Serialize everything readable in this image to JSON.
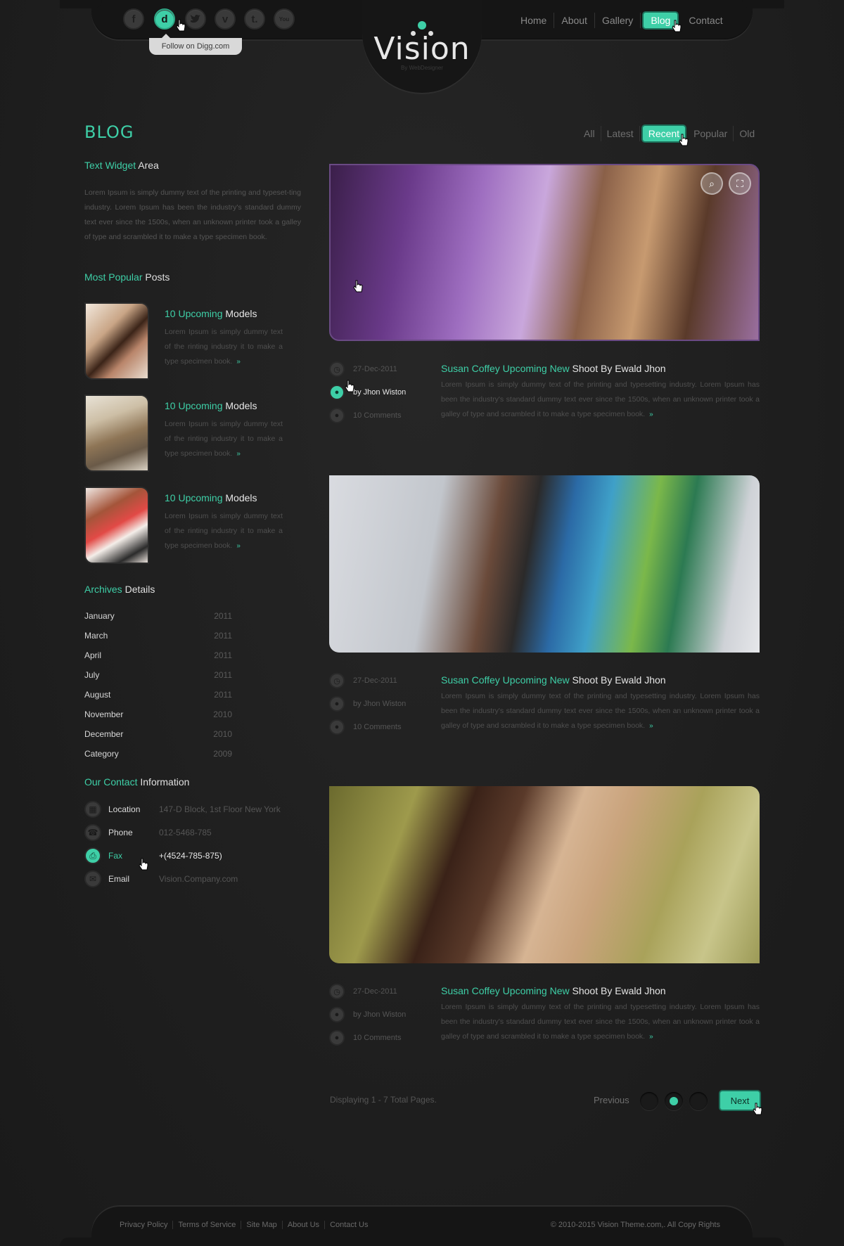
{
  "header": {
    "social": [
      {
        "icon": "facebook-icon",
        "glyph": "f"
      },
      {
        "icon": "digg-icon",
        "glyph": "d"
      },
      {
        "icon": "twitter-icon",
        "glyph": "t"
      },
      {
        "icon": "vimeo-icon",
        "glyph": "v"
      },
      {
        "icon": "tumblr-icon",
        "glyph": "t."
      },
      {
        "icon": "youtube-icon",
        "glyph": "You"
      }
    ],
    "tooltip": "Follow on Digg.com",
    "logo": "Vision",
    "logo_sub": "By WebDesigner",
    "nav": [
      "Home",
      "About",
      "Gallery",
      "Blog",
      "Contact"
    ],
    "nav_active": "Blog"
  },
  "blog": {
    "title": "BLOG",
    "filters": [
      "All",
      "Latest",
      "Recent",
      "Popular",
      "Old"
    ],
    "filter_active": "Recent"
  },
  "sidebar": {
    "text_widget": {
      "accent": "Text Widget",
      "rest": " Area",
      "body": "Lorem Ipsum is simply dummy text of the printing and typeset-ting industry. Lorem Ipsum has been the industry's standard dummy text ever since the 1500s, when an unknown printer took a galley of type and scrambled it to make a type specimen book."
    },
    "popular": {
      "accent": "Most Popular",
      "rest": " Posts",
      "items": [
        {
          "accent": "10 Upcoming",
          "rest": " Models",
          "body": "Lorem Ipsum is simply dummy text of the rinting industry it to make a type specimen book.",
          "more": "»"
        },
        {
          "accent": "10 Upcoming",
          "rest": " Models",
          "body": "Lorem Ipsum is simply dummy text of the rinting industry it to make a type specimen book.",
          "more": "»"
        },
        {
          "accent": "10 Upcoming",
          "rest": " Models",
          "body": "Lorem Ipsum is simply dummy text of the rinting industry it to make a type specimen book.",
          "more": "»"
        }
      ]
    },
    "archives": {
      "accent": "Archives",
      "rest": " Details",
      "items": [
        {
          "month": "January",
          "year": "2011"
        },
        {
          "month": "March",
          "year": "2011"
        },
        {
          "month": "April",
          "year": "2011"
        },
        {
          "month": "July",
          "year": "2011"
        },
        {
          "month": "August",
          "year": "2011"
        },
        {
          "month": "November",
          "year": "2010"
        },
        {
          "month": "December",
          "year": "2010"
        },
        {
          "month": "Category",
          "year": "2009"
        }
      ]
    },
    "contact": {
      "accent": "Our Contact",
      "rest": " Information",
      "items": [
        {
          "icon": "building-icon",
          "glyph": "▦",
          "label": "Location",
          "value": "147-D Block, 1st Floor New York"
        },
        {
          "icon": "phone-icon",
          "glyph": "☎",
          "label": "Phone",
          "value": "012-5468-785"
        },
        {
          "icon": "fax-icon",
          "glyph": "⎙",
          "label": "Fax",
          "value": "+(4524-785-875)"
        },
        {
          "icon": "email-icon",
          "glyph": "✉",
          "label": "Email",
          "value": "Vision.Company.com"
        }
      ],
      "active": "Fax"
    }
  },
  "posts": [
    {
      "date": "27-Dec-2011",
      "author": "by Jhon Wiston",
      "comments": "10 Comments",
      "title_accent": "Susan Coffey Upcoming New",
      "title_rest": " Shoot By Ewald Jhon",
      "body": "Lorem Ipsum is simply dummy text of the printing and typesetting industry. Lorem Ipsum has been the industry's standard dummy text ever since the 1500s, when an unknown printer took a galley of type and scrambled it to make a type specimen book.",
      "more": "»"
    },
    {
      "date": "27-Dec-2011",
      "author": "by Jhon Wiston",
      "comments": "10 Comments",
      "title_accent": "Susan Coffey Upcoming New",
      "title_rest": " Shoot By Ewald Jhon",
      "body": "Lorem Ipsum is simply dummy text of the printing and typesetting industry. Lorem Ipsum has been the industry's standard dummy text ever since the 1500s, when an unknown printer took a galley of type and scrambled it to make a type specimen book.",
      "more": "»"
    },
    {
      "date": "27-Dec-2011",
      "author": "by Jhon Wiston",
      "comments": "10 Comments",
      "title_accent": "Susan Coffey Upcoming New",
      "title_rest": " Shoot By Ewald Jhon",
      "body": "Lorem Ipsum is simply dummy text of the printing and typesetting industry. Lorem Ipsum has been the industry's standard dummy text ever since the 1500s, when an unknown printer took a galley of type and scrambled it to make a type specimen book.",
      "more": "»"
    }
  ],
  "pagination": {
    "displaying": "Displaying 1 - 7 Total Pages.",
    "previous": "Previous",
    "next": "Next",
    "current_page_index": 2
  },
  "footer": {
    "links": [
      "Privacy Policy",
      "Terms of Service",
      "Site Map",
      "About Us",
      "Contact Us"
    ],
    "copyright": "© 2010-2015 Vision Theme.com,. All Copy Rights"
  },
  "colors": {
    "accent": "#3ecfa7",
    "background": "#1f1f1f",
    "bar": "#151515"
  }
}
